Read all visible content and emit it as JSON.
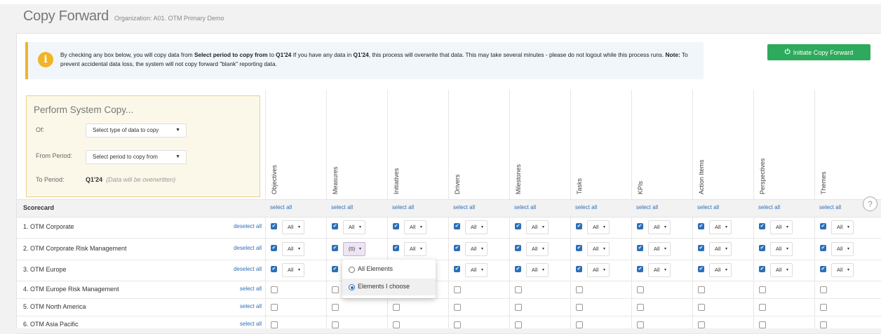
{
  "header": {
    "title": "Copy Forward",
    "org": "Organization: A01. OTM Primary Demo"
  },
  "notice": {
    "icon": "info-icon",
    "text_1": "By checking any box below, you will copy data from ",
    "bold_1": "Select period to copy from",
    "text_2": " to ",
    "bold_2": "Q1'24",
    "text_3": " If you have any data in ",
    "bold_3": "Q1'24",
    "text_4": ", this process will overwrite that data. This may take several minutes - please do not logout while this process runs. ",
    "bold_4": "Note:",
    "text_5": " To prevent accidental data loss, the system will not copy forward \"blank\" reporting data."
  },
  "initiate_button": {
    "label": "Initiate Copy Forward",
    "icon": "power-icon",
    "color": "#2eaa5c"
  },
  "perform": {
    "title": "Perform System Copy...",
    "of_label": "Of:",
    "of_value": "Select type of data to copy",
    "from_label": "From Period:",
    "from_value": "Select period to copy from",
    "to_label": "To Period:",
    "to_value": "Q1'24",
    "to_note": "(Data will be overwritten)"
  },
  "columns": [
    "Objectives",
    "Measures",
    "Initiatives",
    "Drivers",
    "Milestones",
    "Tasks",
    "KPIs",
    "Action Items",
    "Perspectives",
    "Themes"
  ],
  "scorecard_label": "Scorecard",
  "select_all": "select all",
  "deselect_all": "deselect all",
  "select_value": "All",
  "active_select_value": "(0)",
  "rows": [
    {
      "name": "1. OTM Corporate",
      "action": "deselect all"
    },
    {
      "name": "2. OTM Corporate Risk Management",
      "action": "deselect all"
    },
    {
      "name": "3. OTM Europe",
      "action": "deselect all"
    },
    {
      "name": "4. OTM Europe Risk Management",
      "action": "select all"
    },
    {
      "name": "5. OTM North America",
      "action": "select all"
    },
    {
      "name": "6. OTM Asia Pacific",
      "action": "select all"
    }
  ],
  "dropdown": {
    "options": [
      "All Elements",
      "Elements I choose"
    ],
    "selected": "Elements I choose"
  },
  "help_icon": "?"
}
